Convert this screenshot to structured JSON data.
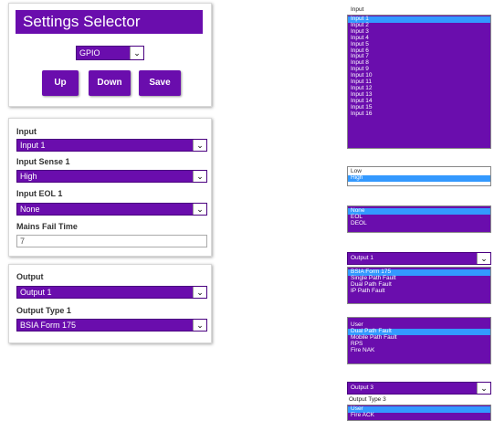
{
  "settings_panel": {
    "title": "Settings Selector",
    "mode_value": "GPIO",
    "up_label": "Up",
    "down_label": "Down",
    "save_label": "Save"
  },
  "input_panel": {
    "input_label": "Input",
    "input_value": "Input 1",
    "sense_label": "Input Sense 1",
    "sense_value": "High",
    "eol_label": "Input EOL 1",
    "eol_value": "None",
    "mains_label": "Mains Fail Time",
    "mains_value": "7"
  },
  "output_panel": {
    "output_label": "Output",
    "output_value": "Output 1",
    "type_label": "Output Type 1",
    "type_value": "BSIA Form 175"
  },
  "right": {
    "input_list_label": "Input",
    "input_options": [
      "Input 1",
      "Input 2",
      "Input 3",
      "Input 4",
      "Input 5",
      "Input 6",
      "Input 7",
      "Input 8",
      "Input 9",
      "Input 10",
      "Input 11",
      "Input 12",
      "Input 13",
      "Input 14",
      "Input 15",
      "Input 16"
    ],
    "sense_options": [
      "Low",
      "High"
    ],
    "eol_options": [
      "None",
      "EOL",
      "DEOL"
    ],
    "output1_value": "Output 1",
    "type_options_a": [
      "BSIA Form 175",
      "Single Path Fault",
      "Dual Path Fault",
      "IP Path Fault"
    ],
    "type_options_b": [
      "User",
      "Dual Path Fault",
      "Mobile Path Fault",
      "RPS",
      "Fire NAK"
    ],
    "output3_value": "Output 3",
    "output_type3_label": "Output Type 3",
    "type_options_c": [
      "User",
      "Fire ACK"
    ]
  },
  "colors": {
    "accent": "#6a0dad",
    "highlight": "#3399ff"
  }
}
